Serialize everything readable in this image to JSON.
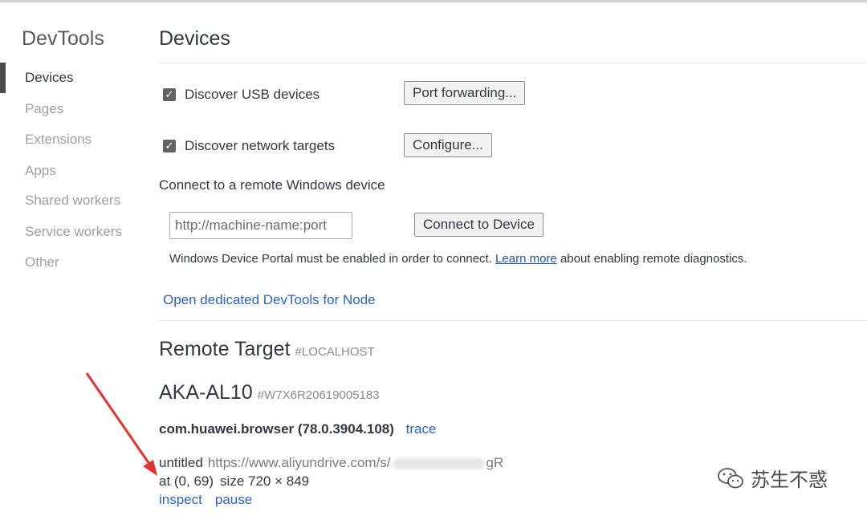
{
  "sidebar": {
    "title": "DevTools",
    "items": [
      {
        "label": "Devices",
        "active": true
      },
      {
        "label": "Pages",
        "active": false
      },
      {
        "label": "Extensions",
        "active": false
      },
      {
        "label": "Apps",
        "active": false
      },
      {
        "label": "Shared workers",
        "active": false
      },
      {
        "label": "Service workers",
        "active": false
      },
      {
        "label": "Other",
        "active": false
      }
    ]
  },
  "main": {
    "title": "Devices",
    "usb": {
      "label": "Discover USB devices",
      "checked": true,
      "button": "Port forwarding..."
    },
    "network": {
      "label": "Discover network targets",
      "checked": true,
      "button": "Configure..."
    },
    "remote_windows": {
      "heading": "Connect to a remote Windows device",
      "placeholder": "http://machine-name:port",
      "button": "Connect to Device",
      "note_before": "Windows Device Portal must be enabled in order to connect.",
      "note_link": "Learn more",
      "note_after": "about enabling remote diagnostics."
    },
    "node_link": "Open dedicated DevTools for Node",
    "remote_target": {
      "title": "Remote Target",
      "tag": "#LOCALHOST"
    },
    "device": {
      "name": "AKA-AL10",
      "serial": "#W7X6R20619005183"
    },
    "browser": {
      "name": "com.huawei.browser (78.0.3904.108)",
      "trace": "trace"
    },
    "page": {
      "title": "untitled",
      "url_start": "https://www.aliyundrive.com/s/",
      "url_end": "gR",
      "position": "at (0, 69)",
      "size": "size 720 × 849",
      "inspect": "inspect",
      "pause": "pause"
    }
  },
  "watermark": {
    "text": "苏生不惑",
    "icon": "wechat-icon"
  },
  "colors": {
    "link": "#2962c8",
    "arrow": "#e8312b",
    "checkbox": "#5f6368"
  }
}
